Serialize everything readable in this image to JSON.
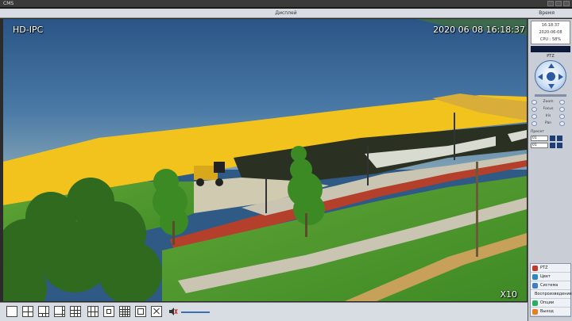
{
  "window": {
    "app_name": "CMS",
    "center_label": "Дисплей",
    "right_label": "Время"
  },
  "video": {
    "camera_label": "HD-IPC",
    "timestamp": "2020 06 08  16:18:37",
    "zoom_label": "X10"
  },
  "panel": {
    "info_lines": [
      "16:18:37",
      "2020-06-08",
      "CPU : 58%"
    ],
    "ptz_title": "PTZ",
    "controls": [
      {
        "label": "Zoom"
      },
      {
        "label": "Focus"
      },
      {
        "label": "Iris"
      },
      {
        "label": "Pan"
      }
    ],
    "preset_label": "Пресет",
    "preset_value": "01",
    "cruise_value": "01",
    "menu": [
      {
        "label": "PTZ",
        "icon": "ptz-icon",
        "color": "#c0392b"
      },
      {
        "label": "Цвет",
        "icon": "color-icon",
        "color": "#2e86c1"
      },
      {
        "label": "Система",
        "icon": "system-icon",
        "color": "#3d7fc4"
      },
      {
        "label": "Воспроизведение",
        "icon": "playback-icon",
        "color": "#7d3c98"
      },
      {
        "label": "Опции",
        "icon": "options-icon",
        "color": "#27ae60"
      },
      {
        "label": "Выход",
        "icon": "exit-icon",
        "color": "#e67e22"
      }
    ]
  },
  "toolbar": {
    "layouts": [
      "layout-1-icon",
      "layout-4-icon",
      "layout-6-icon",
      "layout-8-icon",
      "layout-9-icon",
      "layout-10-icon",
      "layout-13-icon",
      "layout-16-icon",
      "layout-25-icon",
      "fullscreen-icon",
      "volume-icon"
    ]
  }
}
